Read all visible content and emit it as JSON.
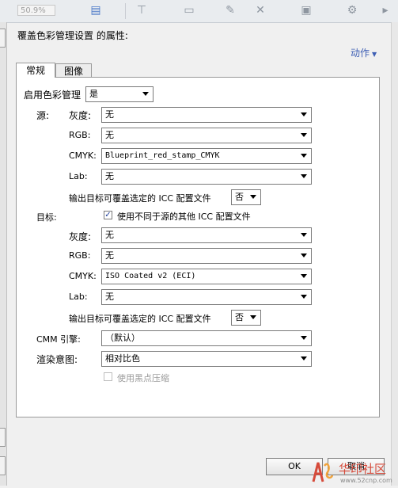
{
  "toolbar": {
    "zoom": "50.9%"
  },
  "panel": {
    "heading": "覆盖色彩管理设置 的属性:",
    "actions": "动作",
    "tabs": [
      {
        "label": "常规",
        "active": true
      },
      {
        "label": "图像",
        "active": false
      }
    ],
    "enable_cm": {
      "label": "启用色彩管理",
      "value": "是"
    },
    "source": {
      "label": "源:",
      "rows": [
        {
          "label": "灰度:",
          "value": "无"
        },
        {
          "label": "RGB:",
          "value": "无"
        },
        {
          "label": "CMYK:",
          "value": "Blueprint_red_stamp_CMYK"
        },
        {
          "label": "Lab:",
          "value": "无"
        }
      ],
      "override_label": "输出目标可覆盖选定的 ICC 配置文件",
      "override_value": "否"
    },
    "target": {
      "label": "目标:",
      "use_other_checked": true,
      "use_other_label": "使用不同于源的其他 ICC 配置文件",
      "rows": [
        {
          "label": "灰度:",
          "value": "无"
        },
        {
          "label": "RGB:",
          "value": "无"
        },
        {
          "label": "CMYK:",
          "value": "ISO Coated v2 (ECI)"
        },
        {
          "label": "Lab:",
          "value": "无"
        }
      ],
      "override_label": "输出目标可覆盖选定的 ICC 配置文件",
      "override_value": "否"
    },
    "cmm": {
      "label": "CMM 引擎:",
      "value": "（默认）"
    },
    "intent": {
      "label": "渲染意图:",
      "value": "相对比色"
    },
    "black_point": {
      "label": "使用黑点压缩",
      "checked": false
    },
    "ok_label": "OK",
    "cancel_label": "取消"
  },
  "watermark": {
    "text": "华印社区",
    "url": "www.52cnp.com"
  },
  "colors": {
    "link": "#3e5fb4",
    "watermark": "#d64a3a"
  }
}
